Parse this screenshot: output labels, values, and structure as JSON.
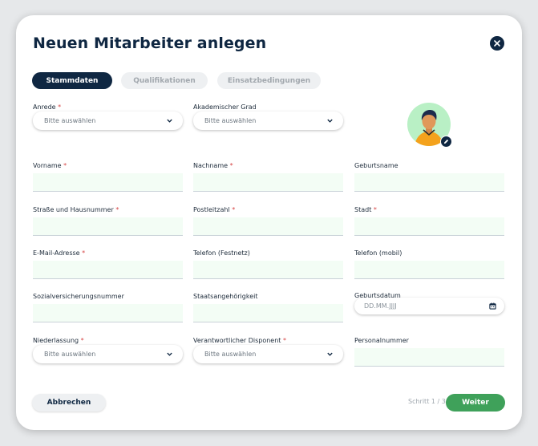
{
  "title": "Neuen Mitarbeiter anlegen",
  "tabs": [
    "Stammdaten",
    "Qualifikationen",
    "Einsatzbedingungen"
  ],
  "required_mark": "*",
  "fields": {
    "anrede": {
      "label": "Anrede",
      "placeholder": "Bitte auswählen"
    },
    "grad": {
      "label": "Akademischer Grad",
      "placeholder": "Bitte auswählen"
    },
    "vorname": {
      "label": "Vorname"
    },
    "nachname": {
      "label": "Nachname"
    },
    "geburtsname": {
      "label": "Geburtsname"
    },
    "strasse": {
      "label": "Straße und Hausnummer"
    },
    "plz": {
      "label": "Postleitzahl"
    },
    "stadt": {
      "label": "Stadt"
    },
    "email": {
      "label": "E-Mail-Adresse"
    },
    "telefon_fest": {
      "label": "Telefon (Festnetz)"
    },
    "telefon_mobil": {
      "label": "Telefon (mobil)"
    },
    "svnr": {
      "label": "Sozialversicherungsnummer"
    },
    "staat": {
      "label": "Staatsangehörigkeit"
    },
    "geburtsdatum": {
      "label": "Geburtsdatum",
      "placeholder": "DD.MM.JJJJ"
    },
    "niederlassung": {
      "label": "Niederlassung",
      "placeholder": "Bitte auswählen"
    },
    "disponent": {
      "label": "Verantwortlicher Disponent",
      "placeholder": "Bitte auswählen"
    },
    "personalnummer": {
      "label": "Personalnummer"
    }
  },
  "buttons": {
    "cancel": "Abbrechen",
    "next": "Weiter"
  },
  "step": "Schritt 1 / 3",
  "colors": {
    "primary": "#0f2742",
    "accent": "#3fa15a",
    "input_bg": "#f3fdf5",
    "required": "#d64545"
  },
  "icons": {
    "close": "close-icon",
    "chevron": "chevron-down-icon",
    "calendar": "calendar-icon",
    "edit": "pencil-icon"
  }
}
